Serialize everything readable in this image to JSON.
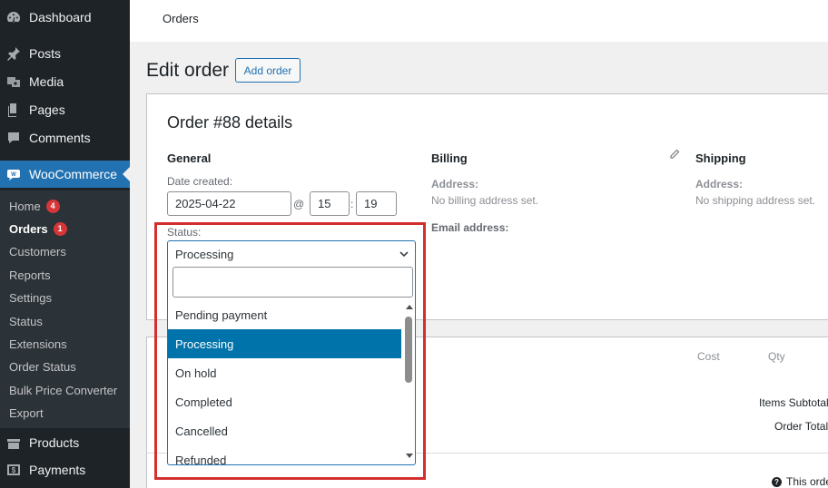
{
  "sidebar": {
    "top_items": [
      {
        "label": "Dashboard",
        "icon": "dashboard-icon"
      },
      {
        "label": "Posts",
        "icon": "pin-icon"
      },
      {
        "label": "Media",
        "icon": "media-icon"
      },
      {
        "label": "Pages",
        "icon": "pages-icon"
      },
      {
        "label": "Comments",
        "icon": "comment-icon"
      }
    ],
    "woocommerce": {
      "label": "WooCommerce",
      "icon": "woocommerce-icon"
    },
    "submenu": [
      {
        "label": "Home",
        "badge": "4"
      },
      {
        "label": "Orders",
        "badge": "1",
        "current": true
      },
      {
        "label": "Customers"
      },
      {
        "label": "Reports"
      },
      {
        "label": "Settings"
      },
      {
        "label": "Status"
      },
      {
        "label": "Extensions"
      },
      {
        "label": "Order Status"
      },
      {
        "label": "Bulk Price Converter"
      },
      {
        "label": "Export"
      }
    ],
    "bottom_items": [
      {
        "label": "Products",
        "icon": "products-icon"
      },
      {
        "label": "Payments",
        "icon": "payments-icon"
      }
    ]
  },
  "header": {
    "title": "Orders"
  },
  "page": {
    "title": "Edit order",
    "add_button": "Add order"
  },
  "order": {
    "heading": "Order #88 details",
    "general": {
      "title": "General",
      "date_label": "Date created:",
      "date": "2025-04-22",
      "at": "@",
      "hour": "15",
      "colon": ":",
      "minute": "19",
      "status_label": "Status:",
      "status_value": "Processing"
    },
    "billing": {
      "title": "Billing",
      "address_label": "Address:",
      "address_value": "No billing address set.",
      "email_label": "Email address:"
    },
    "shipping": {
      "title": "Shipping",
      "address_label": "Address:",
      "address_value": "No shipping address set."
    }
  },
  "status_dropdown": {
    "options": [
      "Pending payment",
      "Processing",
      "On hold",
      "Completed",
      "Cancelled",
      "Refunded"
    ],
    "selected": "Processing"
  },
  "items": {
    "cost_header": "Cost",
    "qty_header": "Qty",
    "items_subtotal": "Items Subtotal:",
    "order_total": "Order Total:",
    "help_text": "This orde"
  },
  "colors": {
    "sidebar_bg": "#1d2327",
    "accent": "#2271b1",
    "selected_option": "#0073aa",
    "highlight_box": "#d42f2f",
    "badge": "#d63638"
  }
}
